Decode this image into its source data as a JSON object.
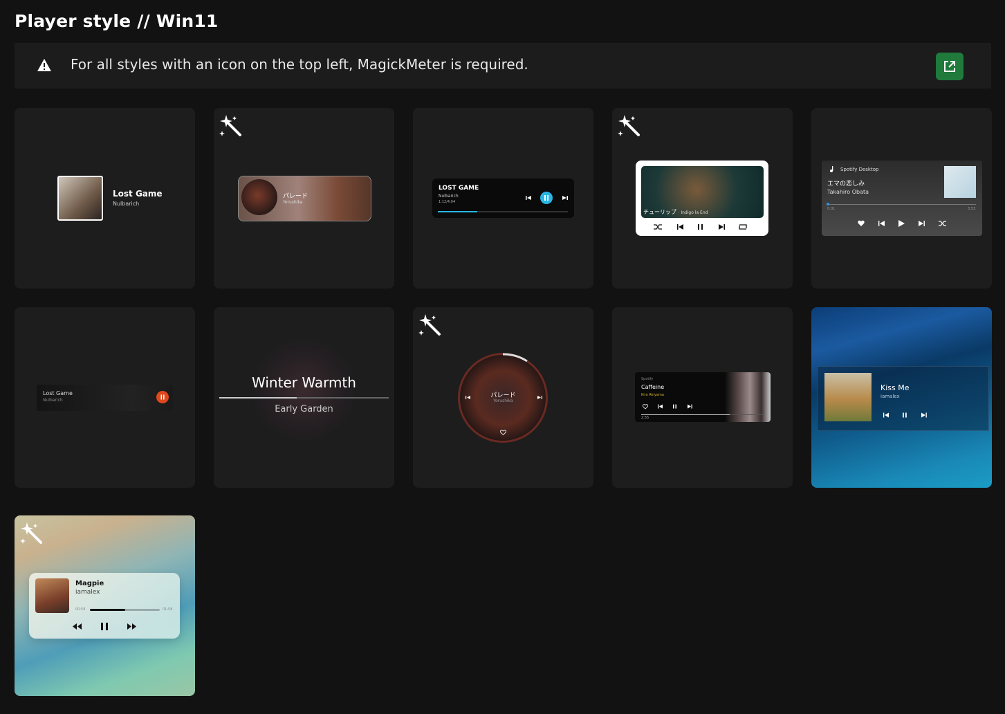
{
  "page": {
    "title": "Player style // Win11"
  },
  "notice": {
    "text": "For all styles with an icon on the top left, MagickMeter is required."
  },
  "cards": [
    {
      "title": "Lost Game",
      "artist": "Nulbarich"
    },
    {
      "title": "パレード",
      "artist": "Yorushika"
    },
    {
      "title": "LOST GAME",
      "artist": "Nulbarich",
      "time": "1:12/4:04"
    },
    {
      "caption": "チューリップ",
      "artist": "· Indigo la End"
    },
    {
      "source": "Spotify Desktop",
      "title": "エマの恋しみ",
      "artist": "Takahiro Obata",
      "time_start": "0:01",
      "time_end": "3:53"
    },
    {
      "title": "Lost Game",
      "artist": "Nulbarich"
    },
    {
      "title": "Winter Warmth",
      "artist": "Early Garden"
    },
    {
      "title": "パレード",
      "artist": "Yorushika"
    },
    {
      "source": "Spotify",
      "title": "Caffeine",
      "artist": "Kiro Akiyama",
      "time": "2:55"
    },
    {
      "title": "Kiss Me",
      "artist": "iamalex"
    },
    {
      "title": "Magpie",
      "artist": "iamalex",
      "time_start": "00:58",
      "time_end": "01:58",
      "progress": 0.5
    }
  ],
  "colors": {
    "accent_green": "#1f7a3c",
    "accent_cyan": "#29b6e6",
    "accent_orange": "#e0481c"
  }
}
